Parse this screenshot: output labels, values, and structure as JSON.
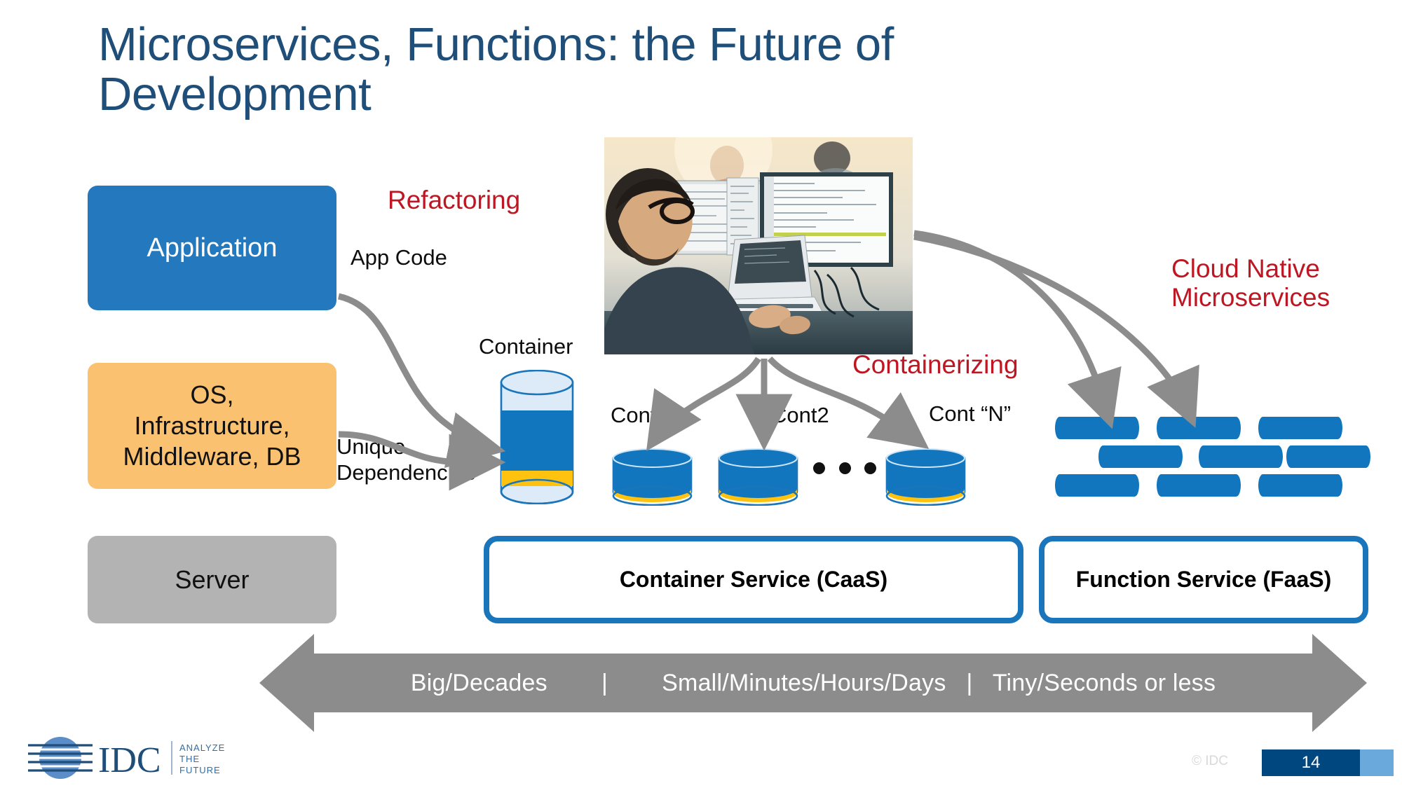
{
  "slide": {
    "title": "Microservices, Functions: the Future of Development",
    "page_number": "14",
    "copyright": "© IDC"
  },
  "stack": {
    "application": "Application",
    "os": "OS,\nInfrastructure,\nMiddleware, DB",
    "server": "Server"
  },
  "annotations": {
    "refactoring": "Refactoring",
    "containerizing": "Containerizing",
    "cloud_native": "Cloud Native\nMicroservices"
  },
  "labels": {
    "app_code": "App Code",
    "unique_dependencies": "Unique\nDependencies",
    "container": "Container",
    "cont1": "Cont1",
    "cont2": "Cont2",
    "contn": "Cont “N”"
  },
  "services": {
    "caas": "Container Service (CaaS)",
    "faas": "Function Service (FaaS)"
  },
  "scale_arrow": {
    "text": "Big/Decades        |        Small/Minutes/Hours/Days   |   Tiny/Seconds or less",
    "segments": [
      "Big/Decades",
      "Small/Minutes/Hours/Days",
      "Tiny/Seconds or less"
    ],
    "separator": "|"
  },
  "logo": {
    "wordmark": "IDC",
    "tagline_line1": "ANALYZE",
    "tagline_line2": "THE",
    "tagline_line3": "FUTURE"
  },
  "photo": {
    "alt": "developer-at-desk-with-code-on-monitors"
  },
  "colors": {
    "title_blue": "#1F4E79",
    "application_blue": "#2478BD",
    "os_orange": "#FAC171",
    "server_gray": "#B3B3B3",
    "accent_red": "#BE1622",
    "service_border_blue": "#1B75BB",
    "brick_blue": "#1276BF",
    "container_fill": "#1276BF",
    "container_band": "#FFC20E",
    "arrow_gray": "#8C8C8C",
    "badge_navy": "#00467F",
    "badge_light": "#6AA9DC"
  }
}
